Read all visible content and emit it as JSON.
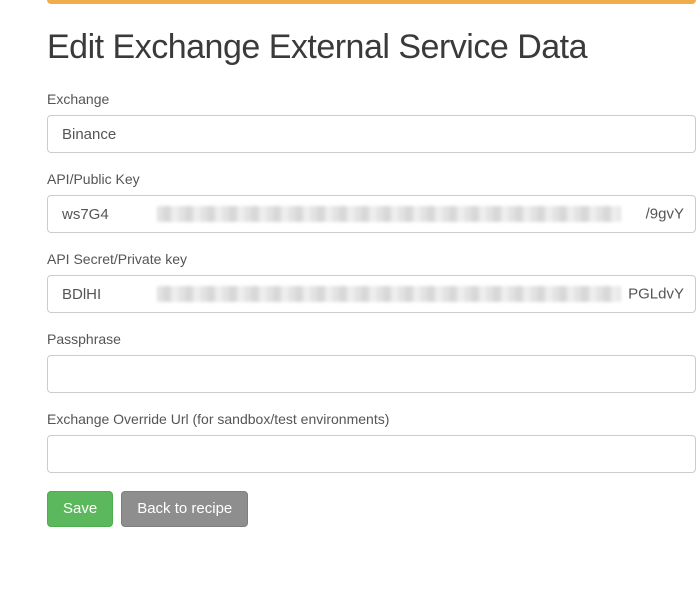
{
  "page": {
    "title": "Edit Exchange External Service Data"
  },
  "form": {
    "exchange": {
      "label": "Exchange",
      "value": "Binance"
    },
    "public_key": {
      "label": "API/Public Key",
      "value_prefix": "ws7G4",
      "value_suffix": "/9gvY"
    },
    "private_key": {
      "label": "API Secret/Private key",
      "value_prefix": "BDlHI",
      "value_suffix": "PGLdvY"
    },
    "passphrase": {
      "label": "Passphrase",
      "value": ""
    },
    "override_url": {
      "label": "Exchange Override Url (for sandbox/test environments)",
      "value": ""
    }
  },
  "buttons": {
    "save": "Save",
    "back": "Back to recipe"
  }
}
